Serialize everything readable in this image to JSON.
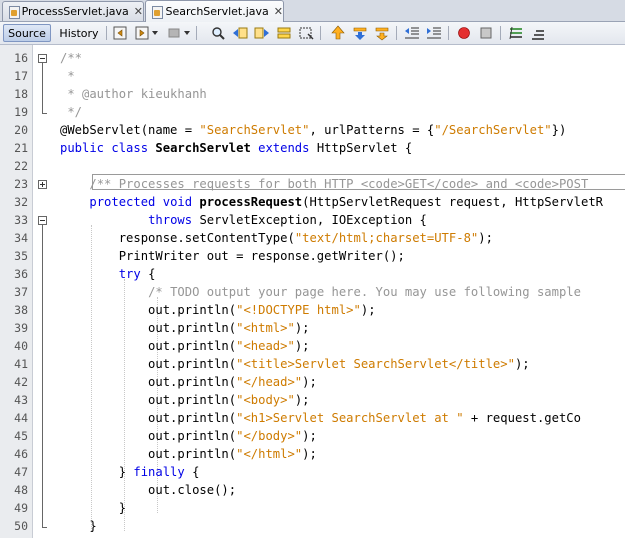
{
  "tabs": [
    {
      "label": "ProcessServlet.java",
      "close": "✕"
    },
    {
      "label": "SearchServlet.java",
      "close": "✕"
    }
  ],
  "toolbar": {
    "source_label": "Source",
    "history_label": "History"
  },
  "gutter": [
    "16",
    "17",
    "18",
    "19",
    "20",
    "21",
    "22",
    "23",
    "32",
    "33",
    "34",
    "35",
    "36",
    "37",
    "38",
    "39",
    "40",
    "41",
    "42",
    "43",
    "44",
    "45",
    "46",
    "47",
    "48",
    "49",
    "50"
  ],
  "code_lines": [
    [
      {
        "t": "/**",
        "c": "cm"
      }
    ],
    [
      {
        "t": " *",
        "c": "cm"
      }
    ],
    [
      {
        "t": " * @author kieukhanh",
        "c": "cm"
      }
    ],
    [
      {
        "t": " */",
        "c": "cm"
      }
    ],
    [
      {
        "t": "@WebServlet(name = "
      },
      {
        "t": "\"SearchServlet\"",
        "c": "str"
      },
      {
        "t": ", urlPatterns = {"
      },
      {
        "t": "\"/SearchServlet\"",
        "c": "str"
      },
      {
        "t": "})"
      }
    ],
    [
      {
        "t": "public class ",
        "c": "kw"
      },
      {
        "t": "SearchServlet ",
        "c": "bold"
      },
      {
        "t": "extends ",
        "c": "kw"
      },
      {
        "t": "HttpServlet {"
      }
    ],
    [
      {
        "t": ""
      }
    ],
    [
      {
        "t": "    "
      },
      {
        "t": "/** Processes requests for both HTTP <code>GET</code> and <code>POST",
        "c": "cm"
      }
    ],
    [
      {
        "t": "    "
      },
      {
        "t": "protected void ",
        "c": "kw"
      },
      {
        "t": "processRequest",
        "c": "bold"
      },
      {
        "t": "(HttpServletRequest request, HttpServletR"
      }
    ],
    [
      {
        "t": "            "
      },
      {
        "t": "throws ",
        "c": "kw"
      },
      {
        "t": "ServletException, IOException {"
      }
    ],
    [
      {
        "t": "        response.setContentType("
      },
      {
        "t": "\"text/html;charset=UTF-8\"",
        "c": "str"
      },
      {
        "t": ");"
      }
    ],
    [
      {
        "t": "        PrintWriter out = response.getWriter();"
      }
    ],
    [
      {
        "t": "        "
      },
      {
        "t": "try ",
        "c": "kw"
      },
      {
        "t": "{"
      }
    ],
    [
      {
        "t": "            "
      },
      {
        "t": "/* TODO output your page here. You may use following sample",
        "c": "cm"
      }
    ],
    [
      {
        "t": "            out.println("
      },
      {
        "t": "\"<!DOCTYPE html>\"",
        "c": "str"
      },
      {
        "t": ");"
      }
    ],
    [
      {
        "t": "            out.println("
      },
      {
        "t": "\"<html>\"",
        "c": "str"
      },
      {
        "t": ");"
      }
    ],
    [
      {
        "t": "            out.println("
      },
      {
        "t": "\"<head>\"",
        "c": "str"
      },
      {
        "t": ");"
      }
    ],
    [
      {
        "t": "            out.println("
      },
      {
        "t": "\"<title>Servlet SearchServlet</title>\"",
        "c": "str"
      },
      {
        "t": ");"
      }
    ],
    [
      {
        "t": "            out.println("
      },
      {
        "t": "\"</head>\"",
        "c": "str"
      },
      {
        "t": ");"
      }
    ],
    [
      {
        "t": "            out.println("
      },
      {
        "t": "\"<body>\"",
        "c": "str"
      },
      {
        "t": ");"
      }
    ],
    [
      {
        "t": "            out.println("
      },
      {
        "t": "\"<h1>Servlet SearchServlet at \"",
        "c": "str"
      },
      {
        "t": " + request.getCo"
      }
    ],
    [
      {
        "t": "            out.println("
      },
      {
        "t": "\"</body>\"",
        "c": "str"
      },
      {
        "t": ");"
      }
    ],
    [
      {
        "t": "            out.println("
      },
      {
        "t": "\"</html>\"",
        "c": "str"
      },
      {
        "t": ");"
      }
    ],
    [
      {
        "t": "        } "
      },
      {
        "t": "finally ",
        "c": "kw"
      },
      {
        "t": "{"
      }
    ],
    [
      {
        "t": "            out.close();"
      }
    ],
    [
      {
        "t": "        }"
      }
    ],
    [
      {
        "t": "    }"
      }
    ]
  ],
  "icons": {
    "tab": "java-file-icon",
    "toolbar": [
      "back-icon",
      "forward-icon",
      "toggle-bookmark-icon",
      "find-icon",
      "find-previous-icon",
      "find-next-icon",
      "toggle-highlight-icon",
      "select-match-icon",
      "shift-up-icon",
      "shift-down-icon",
      "comment-icon",
      "shift-left-icon",
      "shift-right-icon",
      "start-macro-icon",
      "stop-macro-icon",
      "comment-lines-icon",
      "uncomment-lines-icon"
    ]
  },
  "colors": {
    "keyword": "#0000e6",
    "string": "#ce7b00",
    "comment": "#969696",
    "gutter": "#eaecef"
  }
}
